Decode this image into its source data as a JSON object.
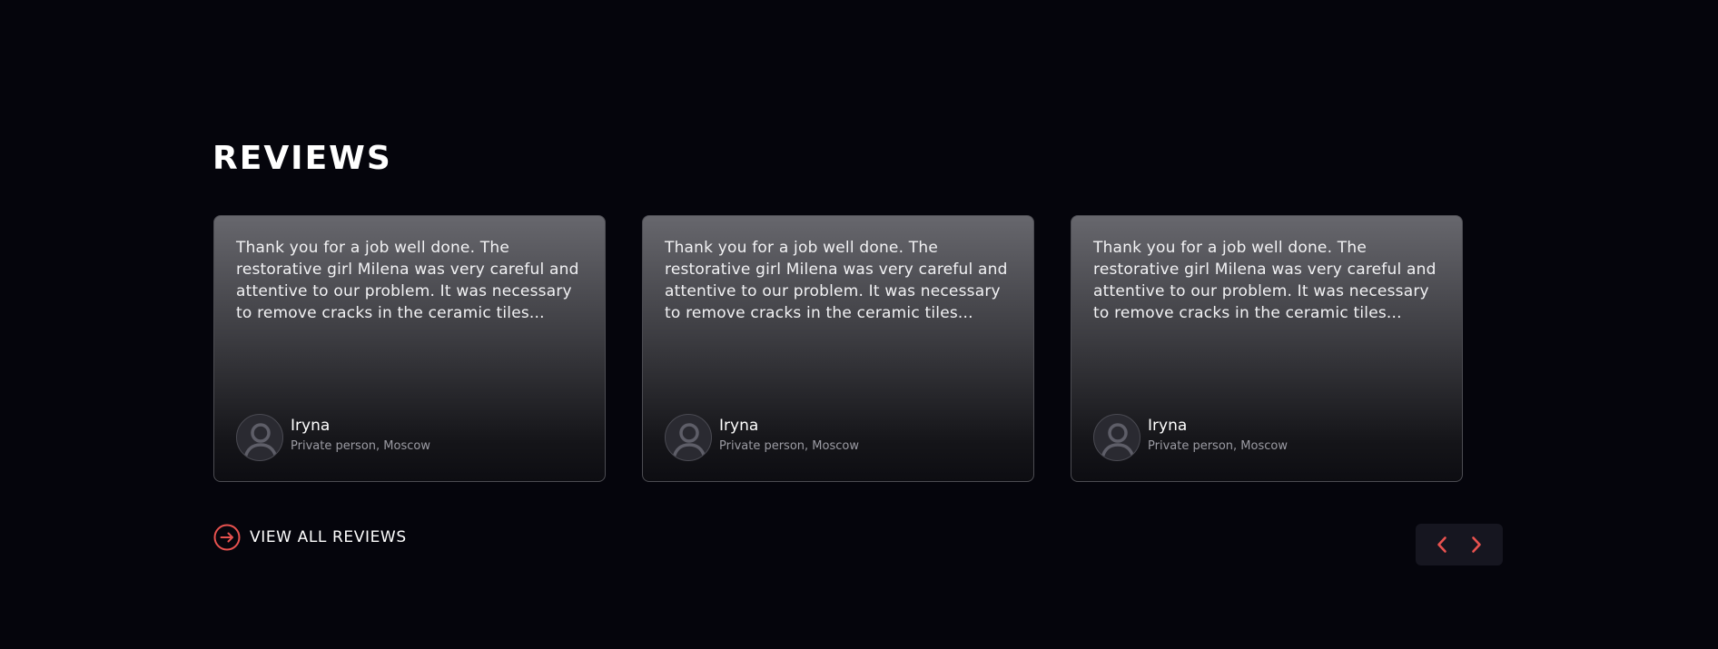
{
  "section": {
    "title": "REVIEWS"
  },
  "reviews": [
    {
      "text": "Thank you for a job well done. The restorative girl Milena was very careful and attentive to our problem. It was necessary to remove cracks in the ceramic tiles...",
      "author_name": "Iryna",
      "author_role": "Private person, Moscow",
      "avatar_icon": "user-avatar-icon"
    },
    {
      "text": "Thank you for a job well done. The restorative girl Milena was very careful and attentive to our problem. It was necessary to remove cracks in the ceramic tiles...",
      "author_name": "Iryna",
      "author_role": "Private person, Moscow",
      "avatar_icon": "user-avatar-icon"
    },
    {
      "text": "Thank you for a job well done. The restorative girl Milena was very careful and attentive to our problem. It was necessary to remove cracks in the ceramic tiles...",
      "author_name": "Iryna",
      "author_role": "Private person, Moscow",
      "avatar_icon": "user-avatar-icon"
    }
  ],
  "view_all": {
    "label": "VIEW ALL REVIEWS",
    "icon": "arrow-right-circle-icon"
  },
  "carousel_nav": {
    "prev_icon": "chevron-left-icon",
    "next_icon": "chevron-right-icon"
  },
  "colors": {
    "background": "#05050c",
    "accent": "#e8524f",
    "text": "#ffffff",
    "muted_text": "#9b9ba3",
    "nav_background": "#161620"
  }
}
